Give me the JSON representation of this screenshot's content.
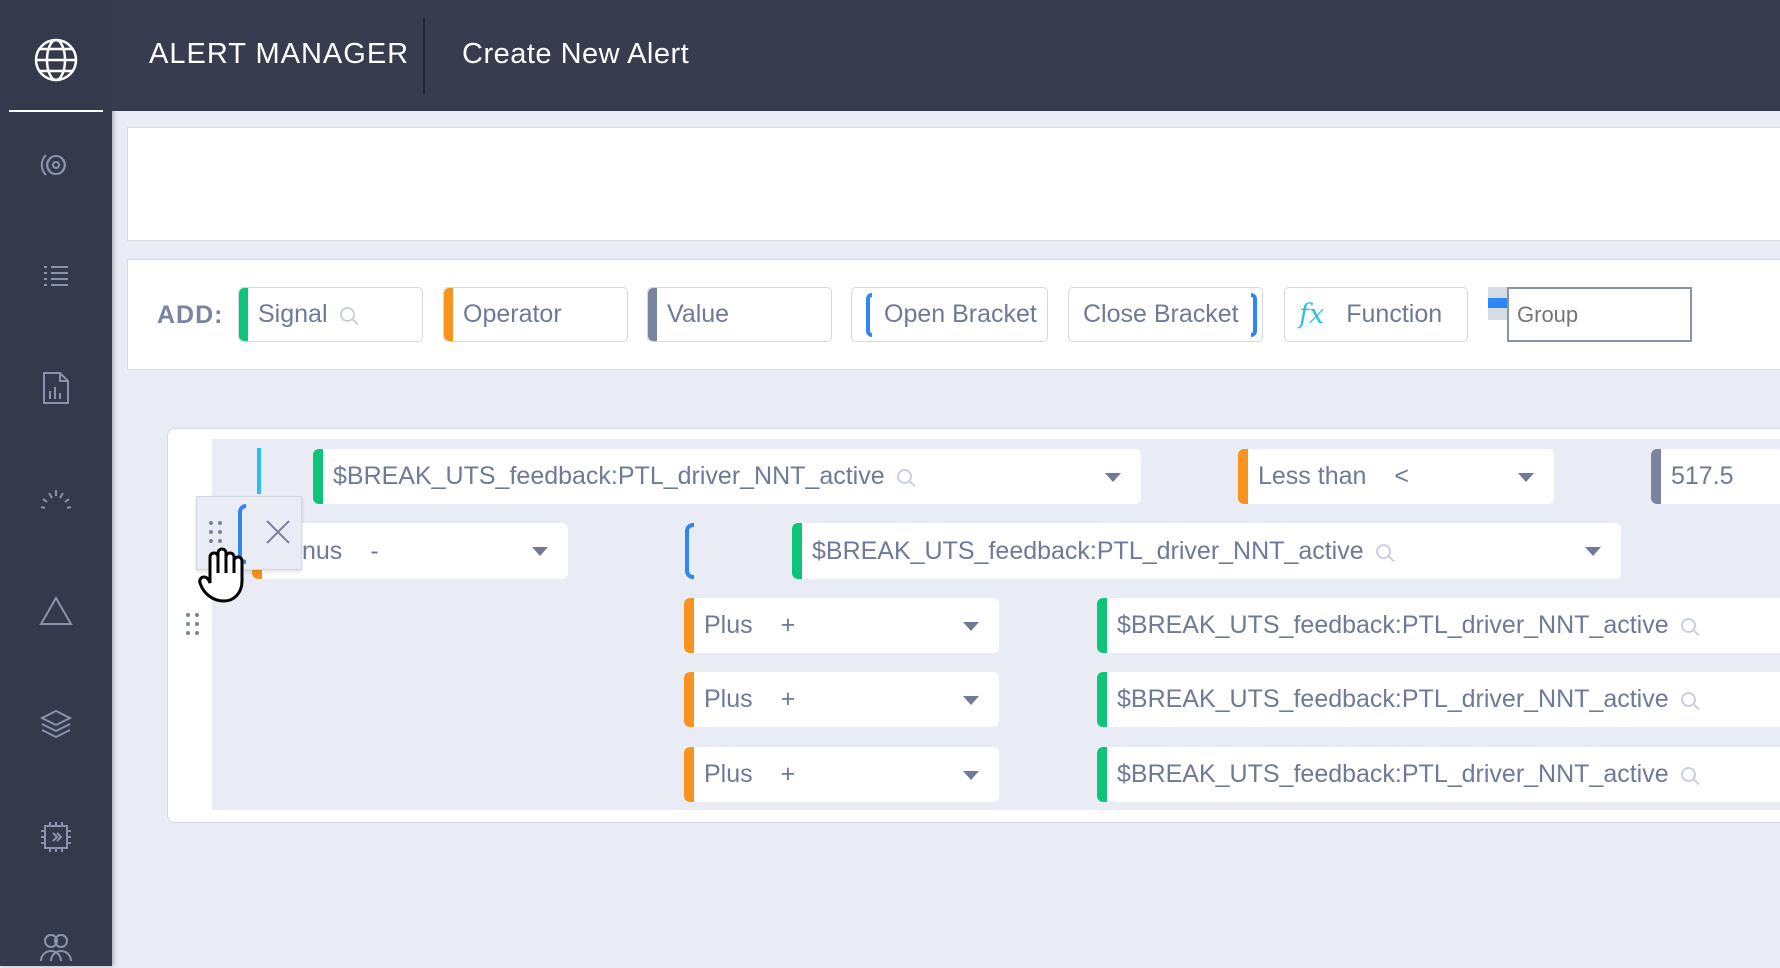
{
  "header": {
    "app_title": "ALERT MANAGER",
    "page_title": "Create New Alert"
  },
  "sidebar": {
    "items": [
      "globe-icon",
      "signal-icon",
      "list-icon",
      "report-icon",
      "gauge-icon",
      "alert-triangle-icon",
      "layers-icon",
      "chip-icon",
      "users-icon"
    ]
  },
  "add_bar": {
    "label": "ADD:",
    "signal": "Signal",
    "operator": "Operator",
    "value": "Value",
    "open_bracket": "Open Bracket",
    "close_bracket": "Close Bracket",
    "function": "Function",
    "function_icon": "fx",
    "group_placeholder": "Group"
  },
  "colors": {
    "signal": "#0ec476",
    "operator": "#f7931e",
    "value": "#7a84a0",
    "bracket": "#2f86f6",
    "function": "#29c0ec"
  },
  "builder": {
    "row1": {
      "signal": "$BREAK_UTS_feedback:PTL_driver_NNT_active",
      "operator": "Less than",
      "operator_symbol": "<",
      "value": "517.5"
    },
    "row2": {
      "operator": "nus",
      "operator_symbol": "-",
      "signal": "$BREAK_UTS_feedback:PTL_driver_NNT_active"
    },
    "rows": [
      {
        "operator": "Plus",
        "operator_symbol": "+",
        "signal": "$BREAK_UTS_feedback:PTL_driver_NNT_active"
      },
      {
        "operator": "Plus",
        "operator_symbol": "+",
        "signal": "$BREAK_UTS_feedback:PTL_driver_NNT_active"
      },
      {
        "operator": "Plus",
        "operator_symbol": "+",
        "signal": "$BREAK_UTS_feedback:PTL_driver_NNT_active"
      }
    ]
  }
}
